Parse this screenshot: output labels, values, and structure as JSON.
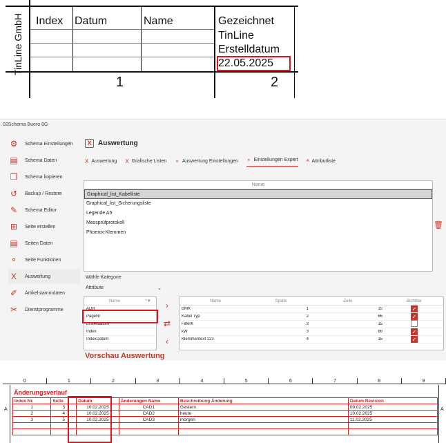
{
  "title_block": {
    "company": "TinLine GmbH",
    "headers": [
      "Index",
      "Datum",
      "Name"
    ],
    "right_cells": [
      "Gezeichnet",
      "TinLine",
      "Erstelldatum",
      "22.05.2025"
    ],
    "column_numbers": [
      "1",
      "2"
    ]
  },
  "window": {
    "title": "02Schema Buero 8G",
    "sidebar": [
      {
        "label": "Schema Einstellungen",
        "icon": "gear-icon",
        "glyph": "⚙"
      },
      {
        "label": "Schema Daten",
        "icon": "document-icon",
        "glyph": "▤"
      },
      {
        "label": "Schema kopieren",
        "icon": "copy-icon",
        "glyph": "❐"
      },
      {
        "label": "Backup / Restore",
        "icon": "restore-icon",
        "glyph": "↺"
      },
      {
        "label": "Schema Editor",
        "icon": "pencil-icon",
        "glyph": "✎"
      },
      {
        "label": "Seite erstellen",
        "icon": "add-page-icon",
        "glyph": "⊞"
      },
      {
        "label": "Seiten Daten",
        "icon": "pages-icon",
        "glyph": "▤"
      },
      {
        "label": "Seite Funktionen",
        "icon": "functions-icon",
        "glyph": "⚬"
      },
      {
        "label": "Auswertung",
        "icon": "excel-icon",
        "glyph": "X"
      },
      {
        "label": "Artikelstammdaten",
        "icon": "edit-icon",
        "glyph": "✐"
      },
      {
        "label": "Dienstprogramme",
        "icon": "tools-icon",
        "glyph": "✂"
      }
    ],
    "section_title": "Auswertung",
    "tabs": [
      {
        "label": "Auswertung",
        "icon": "excel-icon",
        "glyph": "X"
      },
      {
        "label": "Grafische Listen",
        "icon": "excel-icon",
        "glyph": "X"
      },
      {
        "label": "Auswertung Einstellungen",
        "icon": "settings-icon",
        "glyph": "⚬"
      },
      {
        "label": "Einstellungen Expert",
        "icon": "settings-icon",
        "glyph": "⚬"
      },
      {
        "label": "Attributliste",
        "icon": "attribute-icon",
        "glyph": "ᴬ"
      }
    ],
    "name_list": {
      "header": "Name",
      "items": [
        "Graphical_list_Kabelliste",
        "Graphical_list_Sicherungsliste",
        "Legende A5",
        "Messprüfprotokoll",
        "Phoenix-Klemmen"
      ]
    },
    "kategorie_label": "Wähle Kategorie",
    "kategorie_value": "Attribute",
    "left_table": {
      "header": "Name",
      "rows": [
        "ADR",
        "PageNr",
        "Erstelldatum",
        "Index",
        "IndexDatum"
      ]
    },
    "right_table": {
      "headers": [
        "Name",
        "Spalte",
        "Zeile",
        "Sichtbar"
      ],
      "rows": [
        {
          "name": "BMK",
          "spalte": "1",
          "zeile": "15",
          "visible": true
        },
        {
          "name": "Kabel Typ",
          "spalte": "2",
          "zeile": "66",
          "visible": true
        },
        {
          "name": "FilterK",
          "spalte": "3",
          "zeile": "15",
          "visible": false
        },
        {
          "name": "kW",
          "spalte": "3",
          "zeile": "66",
          "visible": true
        },
        {
          "name": "Klemmentext 123",
          "spalte": "4",
          "zeile": "15",
          "visible": true
        }
      ]
    },
    "preview_title": "Vorschau Auswertung"
  },
  "change_log": {
    "ruler": [
      "0",
      "1",
      "2",
      "3",
      "4",
      "5",
      "6",
      "7",
      "8",
      "9"
    ],
    "side_letter": "A",
    "title": "Änderungsverlauf",
    "headers": [
      "Index Nr.",
      "Seite",
      "Datum",
      "Änderungen Name",
      "Beschreibung Änderung",
      "Datum Revision"
    ],
    "rows": [
      [
        "1",
        "3",
        "10.02.2025",
        "CAD1",
        "Gestern",
        "09.02.2025"
      ],
      [
        "2",
        "4",
        "10.02.2025",
        "CAD2",
        "heute",
        "10.02.2025"
      ],
      [
        "3",
        "5",
        "10.02.2025",
        "CAD3",
        "morgen",
        "11.02.2025"
      ]
    ]
  }
}
